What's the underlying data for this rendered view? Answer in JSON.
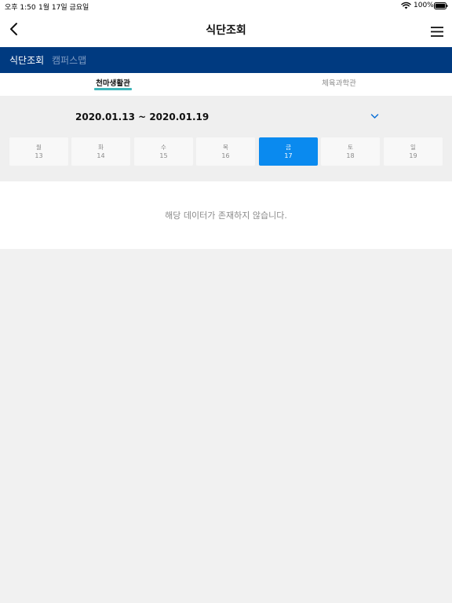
{
  "status_bar": {
    "time": "오후 1:50",
    "date": "1월 17일 금요일",
    "battery_percent": "100%",
    "battery_level": 1.0
  },
  "nav": {
    "title": "식단조회",
    "back_icon": "chevron-left-icon",
    "menu_icon": "hamburger-menu-icon"
  },
  "tabs": [
    {
      "label": "식단조회"
    },
    {
      "label": "캠퍼스맵"
    }
  ],
  "building_tabs": [
    {
      "label": "천마생활관"
    },
    {
      "label": "체육과학관"
    }
  ],
  "week": {
    "range": "2020.01.13 ~ 2020.01.19",
    "days": [
      {
        "name": "월",
        "num": "13"
      },
      {
        "name": "화",
        "num": "14"
      },
      {
        "name": "수",
        "num": "15"
      },
      {
        "name": "목",
        "num": "16"
      },
      {
        "name": "금",
        "num": "17"
      },
      {
        "name": "토",
        "num": "18"
      },
      {
        "name": "일",
        "num": "19"
      }
    ]
  },
  "empty_message": "해당 데이터가 존재하지 않습니다.",
  "colors": {
    "primary_navy": "#003a80",
    "selected_blue": "#0a8aef",
    "tab_underline": "#3fb5b9"
  }
}
